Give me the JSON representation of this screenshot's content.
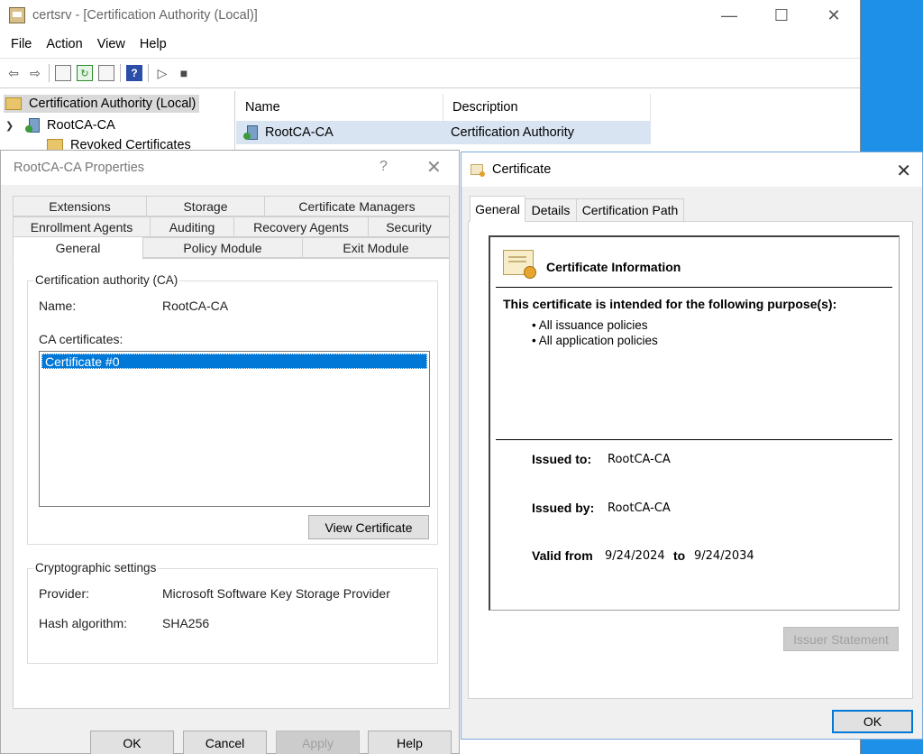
{
  "mmc": {
    "title": "certsrv - [Certification Authority (Local)]",
    "window_controls": {
      "minimize": "—",
      "maximize": "☐",
      "close": "✕"
    },
    "menu": [
      "File",
      "Action",
      "View",
      "Help"
    ],
    "tree": {
      "root": "Certification Authority (Local)",
      "ca": "RootCA-CA",
      "revoked": "Revoked Certificates"
    },
    "list": {
      "col_name": "Name",
      "col_description": "Description",
      "row_name": "RootCA-CA",
      "row_description": "Certification Authority"
    }
  },
  "props": {
    "title": "RootCA-CA Properties",
    "help_glyph": "?",
    "close_glyph": "✕",
    "tabs": {
      "extensions": "Extensions",
      "storage": "Storage",
      "cert_managers": "Certificate Managers",
      "enrollment_agents": "Enrollment Agents",
      "auditing": "Auditing",
      "recovery_agents": "Recovery Agents",
      "security": "Security",
      "general": "General",
      "policy_module": "Policy Module",
      "exit_module": "Exit Module"
    },
    "ca_group": "Certification authority (CA)",
    "name_label": "Name:",
    "name_value": "RootCA-CA",
    "ca_certs_label": "CA certificates:",
    "ca_certs": [
      "Certificate #0"
    ],
    "view_cert": "View Certificate",
    "crypto_group": "Cryptographic settings",
    "provider_label": "Provider:",
    "provider_value": "Microsoft Software Key Storage Provider",
    "hash_label": "Hash algorithm:",
    "hash_value": "SHA256",
    "buttons": {
      "ok": "OK",
      "cancel": "Cancel",
      "apply": "Apply",
      "help": "Help"
    }
  },
  "cert": {
    "title": "Certificate",
    "close_glyph": "✕",
    "tabs": {
      "general": "General",
      "details": "Details",
      "path": "Certification Path"
    },
    "info_heading": "Certificate Information",
    "purpose_heading": "This certificate is intended for the following purpose(s):",
    "purposes": [
      "• All issuance policies",
      "• All application policies"
    ],
    "issued_to_label": "Issued to:",
    "issued_to": "RootCA-CA",
    "issued_by_label": "Issued by:",
    "issued_by": "RootCA-CA",
    "valid_from_label": "Valid from",
    "valid_from": "9/24/2024",
    "to_label": "to",
    "valid_to": "9/24/2034",
    "issuer_statement": "Issuer Statement",
    "ok": "OK"
  }
}
